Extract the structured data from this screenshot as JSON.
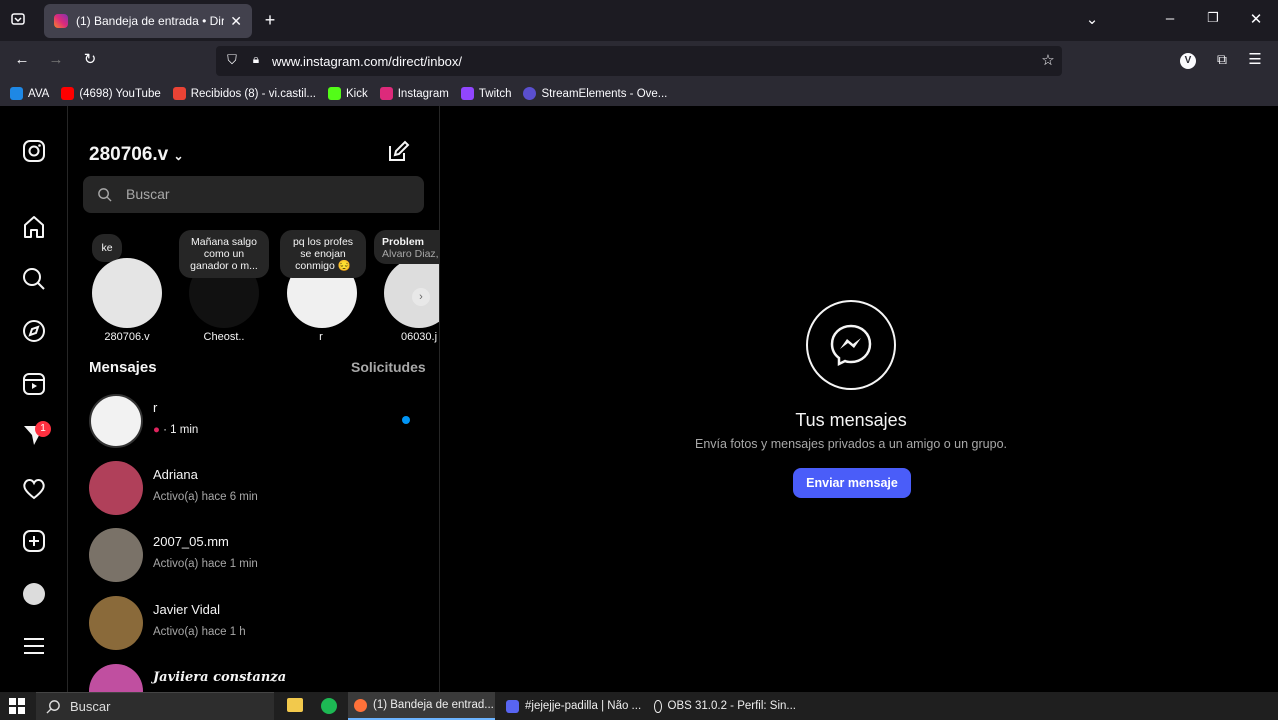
{
  "browser": {
    "tab_title": "(1) Bandeja de entrada • Direct",
    "new_tab": "+",
    "url": "www.instagram.com/direct/inbox/",
    "bookmarks": [
      {
        "label": "AVA",
        "color": "#1e88e5"
      },
      {
        "label": "(4698) YouTube",
        "color": "#ff0000"
      },
      {
        "label": "Recibidos (8) - vi.castil...",
        "color": "#ea4335"
      },
      {
        "label": "Kick",
        "color": "#53fc18"
      },
      {
        "label": "Instagram",
        "color": "#dd2a7b"
      },
      {
        "label": "Twitch",
        "color": "#9146ff"
      },
      {
        "label": "StreamElements - Ove...",
        "color": "#5a4fcf"
      }
    ],
    "profile_initial": "V"
  },
  "sidebar": {
    "notifications_badge": "1"
  },
  "inbox": {
    "username": "280706.v",
    "search_placeholder": "Buscar",
    "notes": [
      {
        "bubble": "ke",
        "name": "280706.v"
      },
      {
        "bubble": "Mañana salgo como un ganador o m...",
        "name": "Cheost.."
      },
      {
        "bubble": "pq los profes se enojan conmigo 😔",
        "name": "r"
      },
      {
        "bubble": "Problem",
        "bubble_sub": "Alvaro Diaz,",
        "name": "06030.j"
      }
    ],
    "messages_label": "Mensajes",
    "requests_label": "Solicitudes",
    "threads": [
      {
        "name": "r",
        "status": "· 1 min",
        "unread": true
      },
      {
        "name": "Adriana",
        "status": "Activo(a) hace 6 min"
      },
      {
        "name": "2007_05.mm",
        "status": "Activo(a) hace 1 min"
      },
      {
        "name": "Javier Vidal",
        "status": "Activo(a) hace 1 h"
      },
      {
        "name": "𝑱𝒂𝒗𝒊𝒊𝒆𝒓𝒂 𝒄𝒐𝒏𝒔𝒕𝒂𝒏𝒛𝒂",
        "status": ""
      }
    ]
  },
  "main": {
    "title": "Tus mensajes",
    "subtitle": "Envía fotos y mensajes privados a un amigo o un grupo.",
    "button": "Enviar mensaje"
  },
  "taskbar": {
    "search": "Buscar",
    "items": [
      "(1) Bandeja de entrad...",
      "#jejejje-padilla | Não ...",
      "OBS 31.0.2 - Perfil: Sin..."
    ]
  }
}
